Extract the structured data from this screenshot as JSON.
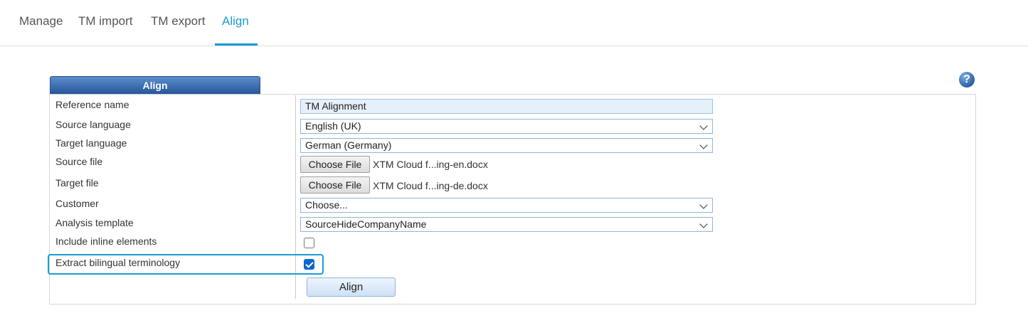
{
  "tabs": [
    {
      "label": "Manage",
      "active": false
    },
    {
      "label": "TM import",
      "active": false
    },
    {
      "label": "TM export",
      "active": false
    },
    {
      "label": "Align",
      "active": true
    }
  ],
  "panel": {
    "title": "Align",
    "help_icon": "?"
  },
  "form": {
    "reference_name": {
      "label": "Reference name",
      "value": "TM Alignment"
    },
    "source_language": {
      "label": "Source language",
      "value": "English (UK)"
    },
    "target_language": {
      "label": "Target language",
      "value": "German (Germany)"
    },
    "source_file": {
      "label": "Source file",
      "button": "Choose File",
      "file": "XTM Cloud f...ing-en.docx"
    },
    "target_file": {
      "label": "Target file",
      "button": "Choose File",
      "file": "XTM Cloud f...ing-de.docx"
    },
    "customer": {
      "label": "Customer",
      "value": "Choose..."
    },
    "analysis_template": {
      "label": "Analysis template",
      "value": "SourceHideCompanyName"
    },
    "include_inline": {
      "label": "Include inline elements",
      "checked": false
    },
    "extract_terminology": {
      "label": "Extract bilingual terminology",
      "checked": true
    },
    "submit_label": "Align"
  },
  "colors": {
    "accent": "#1a9bd7",
    "header_blue": "#27579a",
    "checkbox_blue": "#0b67d0"
  }
}
